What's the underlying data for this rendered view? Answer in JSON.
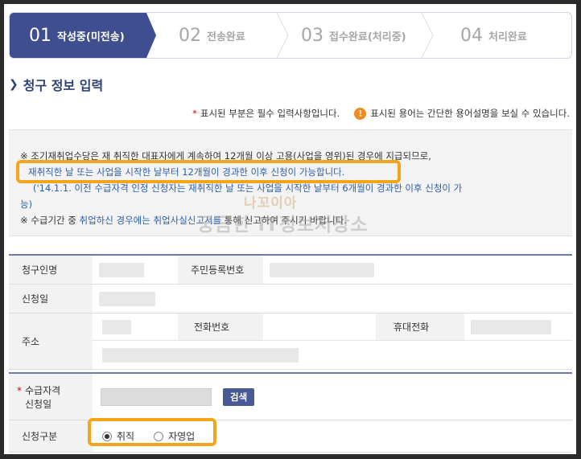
{
  "steps": [
    {
      "num": "01",
      "label": "작성중(미전송)"
    },
    {
      "num": "02",
      "label": "전송완료"
    },
    {
      "num": "03",
      "label": "접수완료(처리중)"
    },
    {
      "num": "04",
      "label": "처리완료"
    }
  ],
  "section_title": "청구 정보 입력",
  "notice": {
    "required": "표시된 부분은 필수 입력사항입니다.",
    "required_mark": "*",
    "info_icon": "!",
    "glossary": "표시된 용어는 간단한 용어설명을 보실 수 있습니다."
  },
  "info": {
    "line1": "※ 조기재취업수당은 재 취직한 대표자에게 계속하여 12개월 이상 고용(사업을 영위)된 경우에 지급되므로,",
    "line2": "재취직한 날 또는 사업을 시작한 날부터 12개월이 경과한 이후 신청이 가능합니다.",
    "line3": "('14.1.1. 이전 수급자격 인정 신청자는 재취직한 날 또는 사업을 시작한 날부터 6개월이 경과한 이후 신청이 가",
    "line4": "능)",
    "line5_a": "※ 수급기간 중",
    "line5_b": "취업하신 경우에는 취업사실신고서를",
    "line5_c": "통해 신고하여 주시기 바랍니다."
  },
  "watermark": {
    "small": "나꼬이아",
    "main": "궁금한 IT정보저장소"
  },
  "form1": {
    "claimant_label": "청구인명",
    "rrn_label": "주민등록번호",
    "date_label": "신청일",
    "address_label": "주소",
    "phone_label": "전화번호",
    "mobile_label": "휴대전화"
  },
  "form2": {
    "qual_label_1": "수급자격",
    "qual_label_2": "신청일",
    "search_button": "검색",
    "type_label": "신청구분",
    "options": [
      "취직",
      "자영업"
    ],
    "selected_option": "취직"
  },
  "colors": {
    "accent": "#3e4e8e",
    "highlight": "#f4a51c",
    "required": "#d0021b"
  }
}
